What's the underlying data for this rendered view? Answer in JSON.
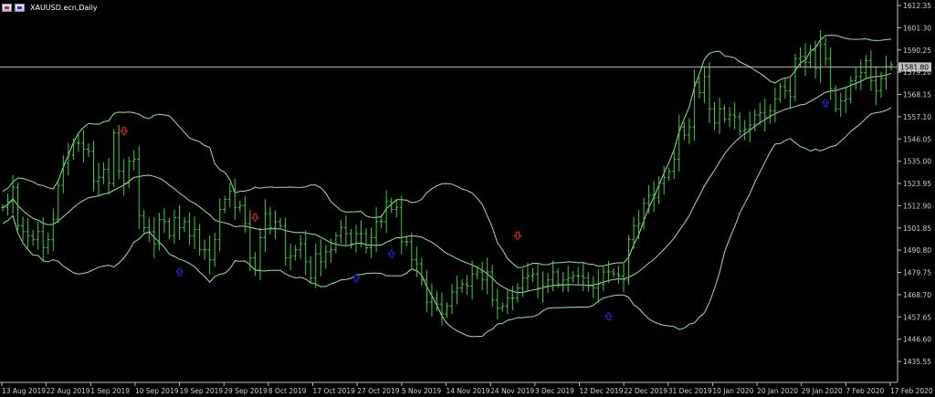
{
  "window": {
    "title": "XAUUSD.ecn,Daily"
  },
  "colors": {
    "background": "#000000",
    "candle": "#3ecf3e",
    "band": "#98e898",
    "axis": "#c0c0c0",
    "arrow_down": "#cc2222",
    "arrow_up": "#2222cc",
    "current_price_line": "#b8b8b8",
    "price_box": "#c0c0c0"
  },
  "price_axis": {
    "labels": [
      "1612.35",
      "1601.30",
      "1590.25",
      "1579.20",
      "1568.15",
      "1557.10",
      "1546.05",
      "1535.00",
      "1523.95",
      "1512.90",
      "1501.85",
      "1490.80",
      "1479.75",
      "1468.70",
      "1457.65",
      "1446.60",
      "1435.55"
    ],
    "current_price": "1581.80"
  },
  "time_axis": {
    "labels": [
      "13 Aug 2019",
      "22 Aug 2019",
      "1 Sep 2019",
      "10 Sep 2019",
      "19 Sep 2019",
      "29 Sep 2019",
      "8 Oct 2019",
      "17 Oct 2019",
      "27 Oct 2019",
      "5 Nov 2019",
      "14 Nov 2019",
      "24 Nov 2019",
      "3 Dec 2019",
      "12 Dec 2019",
      "22 Dec 2019",
      "31 Dec 2019",
      "10 Jan 2020",
      "20 Jan 2020",
      "29 Jan 2020",
      "7 Feb 2020",
      "17 Feb 2020"
    ]
  },
  "chart_data": {
    "type": "ohlc",
    "symbol": "XAUUSD.ecn",
    "timeframe": "Daily",
    "ylim": [
      1431,
      1614
    ],
    "close": [
      1512,
      1515,
      1522,
      1503,
      1500,
      1498,
      1496,
      1500,
      1492,
      1496,
      1506,
      1523,
      1534,
      1538,
      1544,
      1544,
      1541,
      1540,
      1525,
      1527,
      1531,
      1524,
      1549,
      1530,
      1524,
      1535,
      1536,
      1508,
      1502,
      1500,
      1494,
      1506,
      1505,
      1498,
      1507,
      1502,
      1505,
      1498,
      1501,
      1491,
      1491,
      1486,
      1496,
      1511,
      1516,
      1520,
      1512,
      1513,
      1504,
      1487,
      1481,
      1497,
      1509,
      1502,
      1505,
      1503,
      1487,
      1488,
      1491,
      1494,
      1485,
      1477,
      1489,
      1485,
      1490,
      1491,
      1498,
      1502,
      1499,
      1494,
      1499,
      1499,
      1492,
      1497,
      1505,
      1505,
      1515,
      1511,
      1512,
      1495,
      1495,
      1486,
      1484,
      1476,
      1465,
      1467,
      1464,
      1459,
      1463,
      1470,
      1472,
      1474,
      1473,
      1479,
      1480,
      1476,
      1480,
      1466,
      1462,
      1463,
      1467,
      1467,
      1472,
      1477,
      1478,
      1479,
      1472,
      1473,
      1476,
      1480,
      1474,
      1476,
      1477,
      1478,
      1478,
      1477,
      1473,
      1472,
      1474,
      1480,
      1480,
      1479,
      1478,
      1476,
      1496,
      1503,
      1504,
      1514,
      1518,
      1517,
      1524,
      1527,
      1530,
      1536,
      1552,
      1548,
      1552,
      1574,
      1569,
      1577,
      1561,
      1554,
      1561,
      1556,
      1558,
      1557,
      1550,
      1551,
      1553,
      1558,
      1559,
      1557,
      1560,
      1566,
      1572,
      1570,
      1567,
      1586,
      1587,
      1584,
      1590,
      1581,
      1593,
      1586,
      1571,
      1561,
      1565,
      1566,
      1575,
      1577,
      1579,
      1585,
      1575,
      1570,
      1576,
      1582,
      1583
    ]
  },
  "markers": {
    "down_arrows": [
      {
        "date_index": 24
      },
      {
        "date_index": 50
      },
      {
        "date_index": 102
      }
    ],
    "up_arrows": [
      {
        "date_index": 35
      },
      {
        "date_index": 70
      },
      {
        "date_index": 77
      },
      {
        "date_index": 120
      },
      {
        "date_index": 163
      }
    ]
  }
}
